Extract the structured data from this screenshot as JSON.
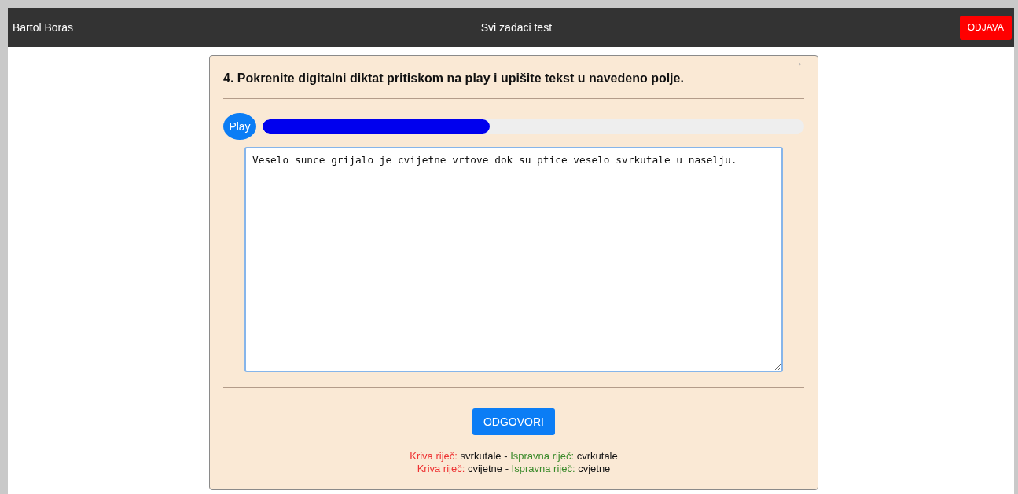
{
  "header": {
    "user": "Bartol Boras",
    "title": "Svi zadaci test",
    "logout": "ODJAVA"
  },
  "task": {
    "next_arrow": "→",
    "question": "4. Pokrenite digitalni diktat pritiskom na play i upišite tekst u navedeno polje.",
    "player": {
      "button": "Play",
      "level": 0.42
    },
    "answer": "Veselo sunce grijalo je cvijetne vrtove dok su ptice veselo svrkutale u naselju.",
    "submit": "ODGOVORI",
    "feedback": [
      {
        "wrong_label": "Kriva riječ:",
        "wrong_word": "svrkutale",
        "separator": "-",
        "correct_label": "Ispravna riječ:",
        "correct_word": "cvrkutale"
      },
      {
        "wrong_label": "Kriva riječ:",
        "wrong_word": "cvijetne",
        "separator": "-",
        "correct_label": "Ispravna riječ:",
        "correct_word": "cvjetne"
      }
    ]
  }
}
